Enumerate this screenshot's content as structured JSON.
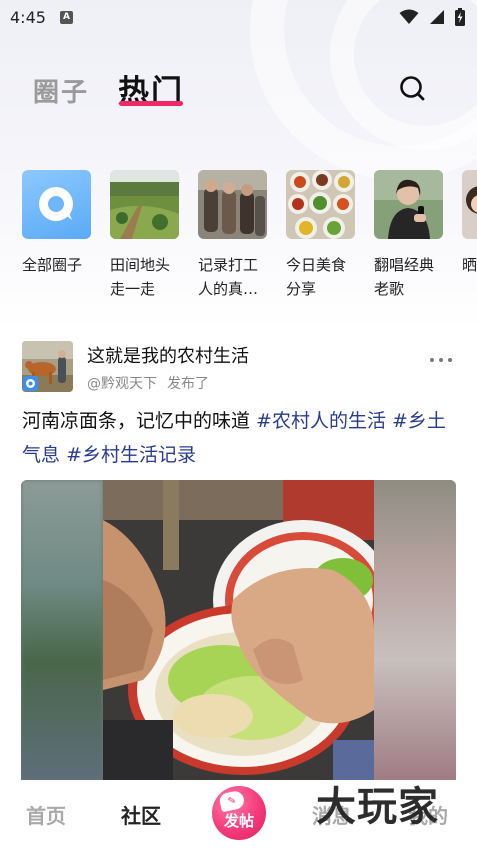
{
  "status_bar": {
    "time": "4:45",
    "notification_icon_letter": "A",
    "icons": [
      "app-notification-icon",
      "wifi-icon",
      "signal-icon",
      "battery-charging-icon"
    ]
  },
  "header": {
    "tabs": [
      {
        "label": "圈子",
        "selected": false
      },
      {
        "label": "热门",
        "selected": true
      }
    ],
    "accent_color": "#f02868",
    "search_icon": "search-icon"
  },
  "circles": [
    {
      "label": "全部圈子",
      "icon": "chat-bubble-icon"
    },
    {
      "label": "田间地头走一走",
      "icon": "field-photo"
    },
    {
      "label": "记录打工人的真…",
      "icon": "workers-photo"
    },
    {
      "label": "今日美食分享",
      "icon": "food-photo"
    },
    {
      "label": "翻唱经典老歌",
      "icon": "singer-photo"
    },
    {
      "label": "晒孩",
      "icon": "child-photo"
    }
  ],
  "post": {
    "title": "这就是我的农村生活",
    "author": "@黔观天下",
    "action": "发布了",
    "text": "河南凉面条，记忆中的味道 ",
    "tags": [
      "#农村人的生活",
      "#乡土气息",
      "#乡村生活记录"
    ],
    "tag_color": "#283c8c",
    "more_icon": "more-dots-icon"
  },
  "bottom_nav": {
    "items": [
      {
        "label": "首页",
        "selected": false
      },
      {
        "label": "社区",
        "selected": true
      },
      {
        "label": "发帖",
        "selected": false
      },
      {
        "label": "消息",
        "selected": false
      },
      {
        "label": "我的",
        "selected": false
      }
    ],
    "post_button_color": "#f53a7a"
  },
  "watermark": "大玩家"
}
